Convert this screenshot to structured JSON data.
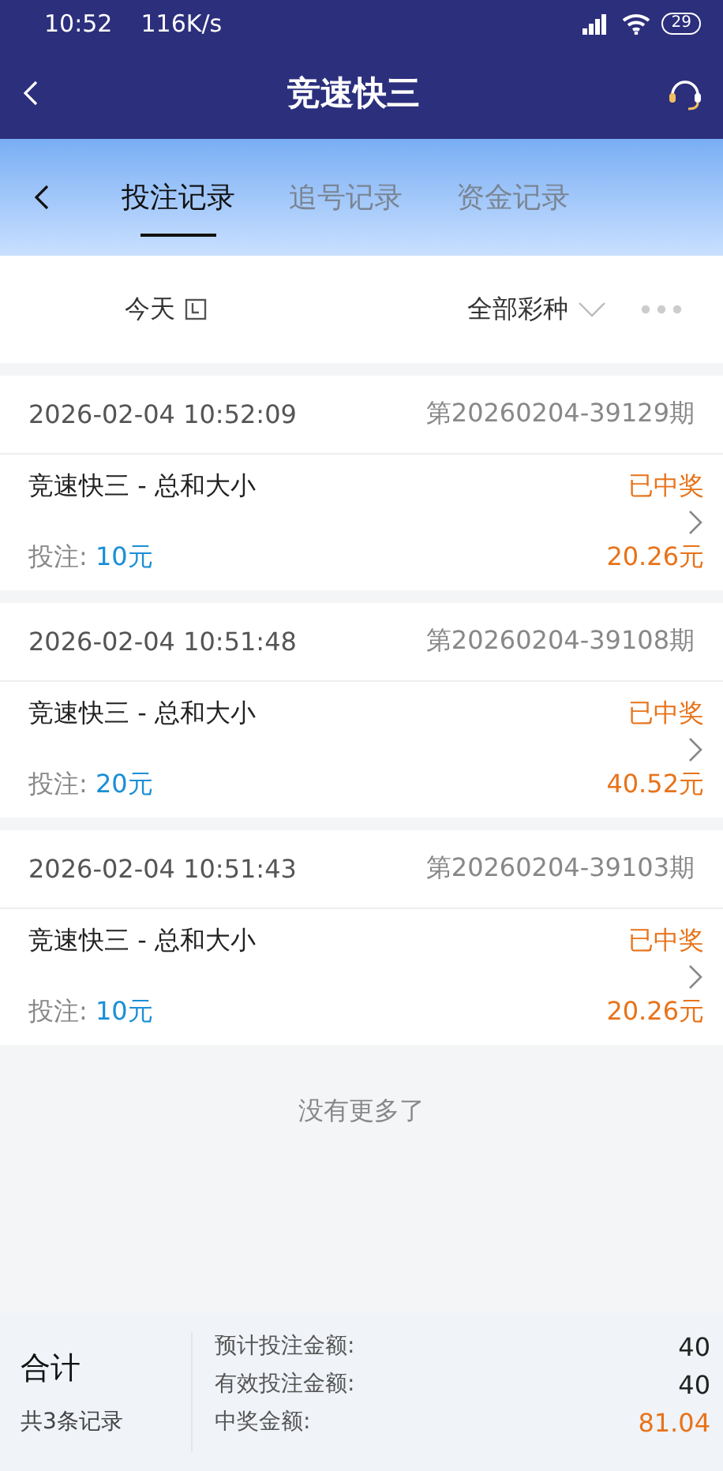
{
  "status_bar": {
    "time": "10:52",
    "speed": "116K/s",
    "battery": "29"
  },
  "header": {
    "title": "竞速快三"
  },
  "tabs": [
    {
      "label": "投注记录",
      "selected": true
    },
    {
      "label": "追号记录",
      "selected": false
    },
    {
      "label": "资金记录",
      "selected": false
    }
  ],
  "filters": {
    "date": "今天",
    "lottery": "全部彩种"
  },
  "records": [
    {
      "time": "2026-02-04 10:52:09",
      "issue": "第20260204-39129期",
      "game": "竞速快三 - 总和大小",
      "status": "已中奖",
      "bet_label": "投注:",
      "bet": "10元",
      "payout": "20.26元"
    },
    {
      "time": "2026-02-04 10:51:48",
      "issue": "第20260204-39108期",
      "game": "竞速快三 - 总和大小",
      "status": "已中奖",
      "bet_label": "投注:",
      "bet": "20元",
      "payout": "40.52元"
    },
    {
      "time": "2026-02-04 10:51:43",
      "issue": "第20260204-39103期",
      "game": "竞速快三 - 总和大小",
      "status": "已中奖",
      "bet_label": "投注:",
      "bet": "10元",
      "payout": "20.26元"
    }
  ],
  "end_note": "没有更多了",
  "summary": {
    "title": "合计",
    "count": "共3条记录",
    "rows": [
      {
        "label": "预计投注金额:",
        "value": "40",
        "kind": "plain"
      },
      {
        "label": "有效投注金额:",
        "value": "40",
        "kind": "plain"
      },
      {
        "label": "中奖金额:",
        "value": "81.04",
        "kind": "win"
      }
    ]
  }
}
